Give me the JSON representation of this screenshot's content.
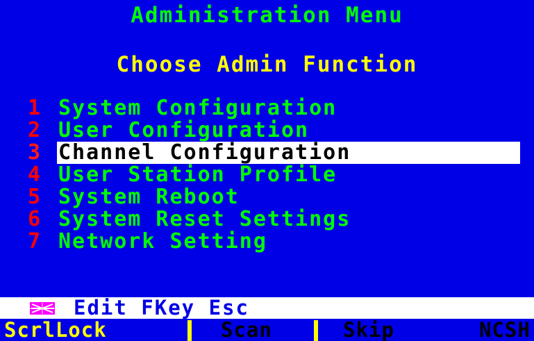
{
  "header": {
    "title": "Administration Menu",
    "subtitle": "Choose Admin Function"
  },
  "menu": {
    "items": [
      {
        "number": "1",
        "label": "System Configuration",
        "selected": false
      },
      {
        "number": "2",
        "label": "User Configuration",
        "selected": false
      },
      {
        "number": "3",
        "label": "Channel Configuration",
        "selected": true
      },
      {
        "number": "4",
        "label": "User Station Profile",
        "selected": false
      },
      {
        "number": "5",
        "label": "System Reboot",
        "selected": false
      },
      {
        "number": "6",
        "label": "System Reset Settings",
        "selected": false
      },
      {
        "number": "7",
        "label": "Network Setting",
        "selected": false
      }
    ]
  },
  "status_bar": {
    "icon": "keyboard-icon",
    "text": "Edit FKey Esc"
  },
  "function_keys": [
    {
      "label": "ScrlLock",
      "active": true
    },
    {
      "label": "Scan",
      "active": false
    },
    {
      "label": "Skip",
      "active": false
    },
    {
      "label": "NCSH",
      "active": false
    }
  ],
  "colors": {
    "background": "#0000e6",
    "title": "#00ff00",
    "subtitle": "#ffff00",
    "menu_number": "#ff0000",
    "menu_label": "#00ff00",
    "selection_bg": "#ffffff",
    "selection_fg": "#000000",
    "fkey_active": "#ffff00",
    "fkey_inactive": "#000000"
  }
}
